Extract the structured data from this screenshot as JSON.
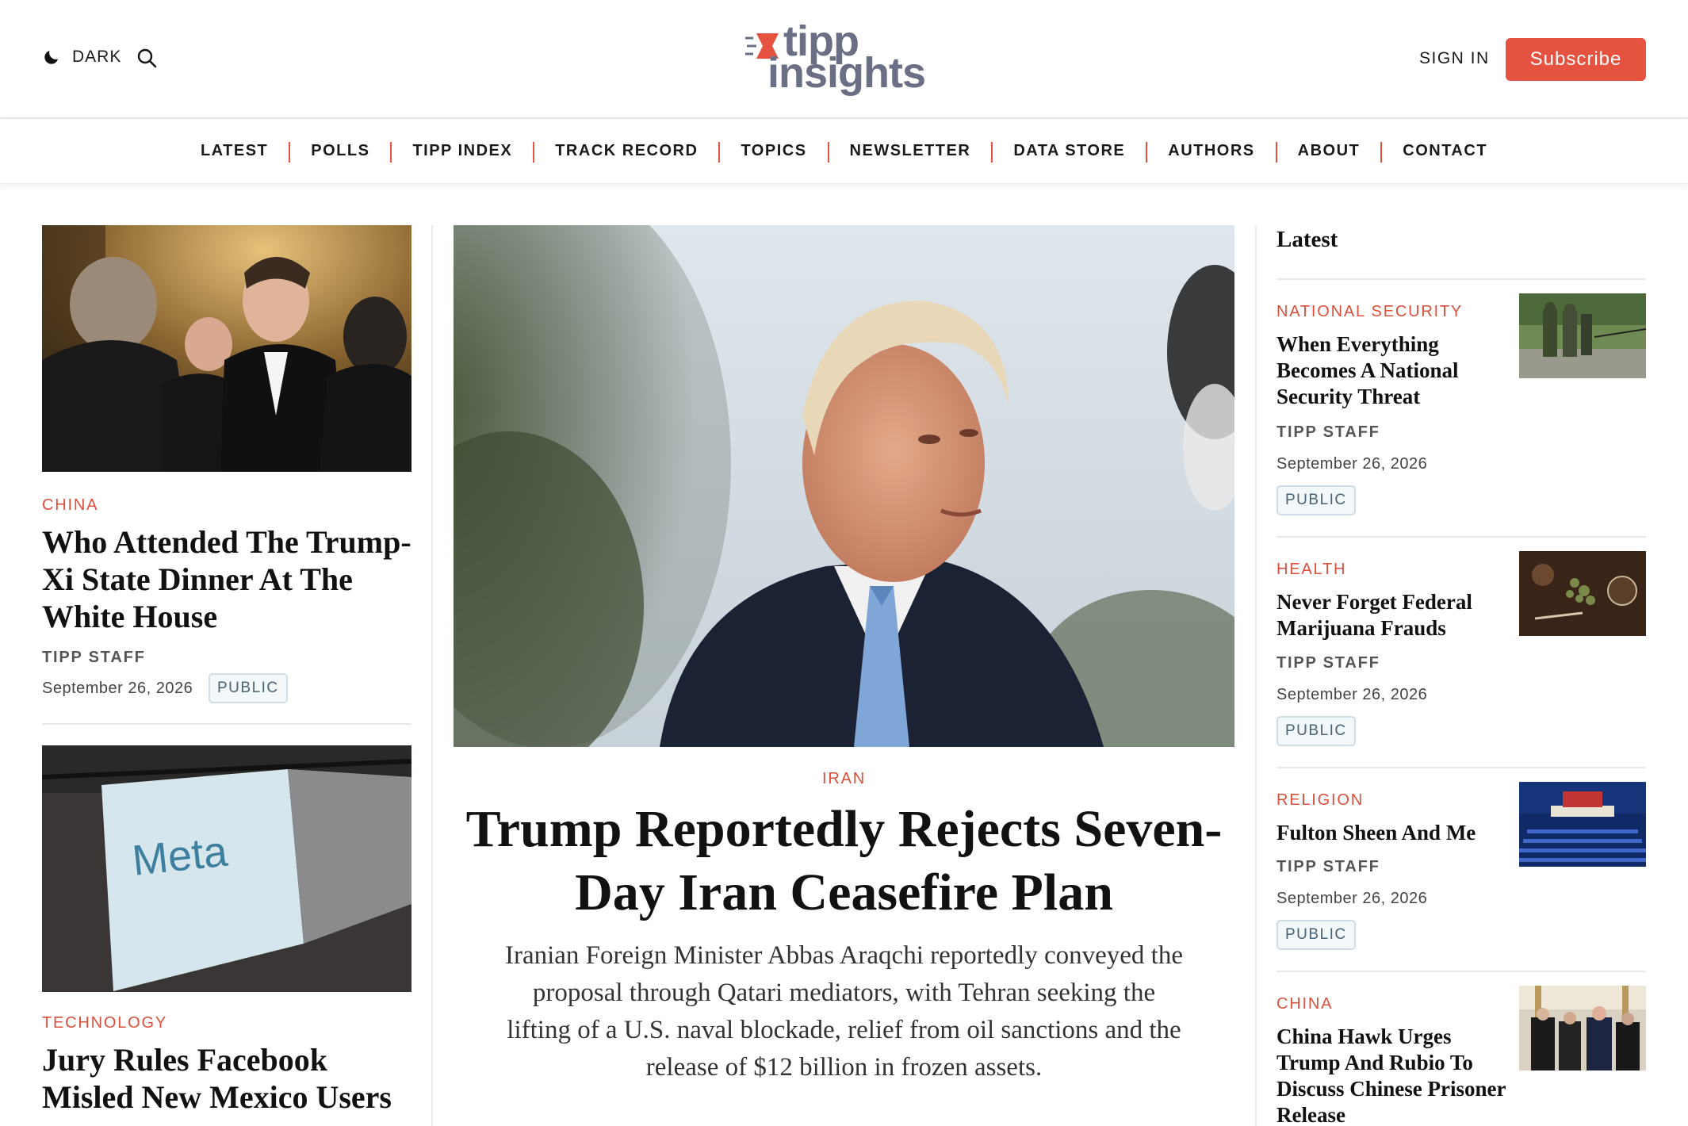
{
  "header": {
    "dark_label": "DARK",
    "logo_top": "tipp",
    "logo_bottom": "insights",
    "signin_label": "SIGN IN",
    "subscribe_label": "Subscribe"
  },
  "nav": [
    "LATEST",
    "POLLS",
    "TIPP INDEX",
    "TRACK RECORD",
    "TOPICS",
    "NEWSLETTER",
    "DATA STORE",
    "AUTHORS",
    "ABOUT",
    "CONTACT"
  ],
  "left": {
    "story1": {
      "kicker": "CHINA",
      "title": "Who Attended The Trump-Xi State Dinner At The White House",
      "byline": "TIPP STAFF",
      "date": "September 26, 2026",
      "badge": "PUBLIC"
    },
    "story2": {
      "kicker": "TECHNOLOGY",
      "title": "Jury Rules Facebook Misled New Mexico Users",
      "image_text": "Meta"
    }
  },
  "hero": {
    "kicker": "IRAN",
    "title": "Trump Reportedly Rejects Seven-Day Iran Ceasefire Plan",
    "dek": "Iranian Foreign Minister Abbas Araqchi reportedly conveyed the proposal through Qatari mediators, with Tehran seeking the lifting of a U.S. naval blockade, relief from oil sanctions and the release of $12 billion in frozen assets."
  },
  "latest": {
    "heading": "Latest",
    "items": [
      {
        "kicker": "NATIONAL SECURITY",
        "title": "When Everything Becomes A National Security Threat",
        "byline": "TIPP STAFF",
        "date": "September 26, 2026",
        "badge": "PUBLIC"
      },
      {
        "kicker": "HEALTH",
        "title": "Never Forget Federal Marijuana Frauds",
        "byline": "TIPP STAFF",
        "date": "September 26, 2026",
        "badge": "PUBLIC"
      },
      {
        "kicker": "RELIGION",
        "title": "Fulton Sheen And Me",
        "byline": "TIPP STAFF",
        "date": "September 26, 2026",
        "badge": "PUBLIC"
      },
      {
        "kicker": "CHINA",
        "title": "China Hawk Urges Trump And Rubio To Discuss Chinese Prisoner Release"
      }
    ]
  },
  "colors": {
    "accent": "#e5523f",
    "logo": "#6b6f86",
    "badge_border": "#cfdde6"
  }
}
